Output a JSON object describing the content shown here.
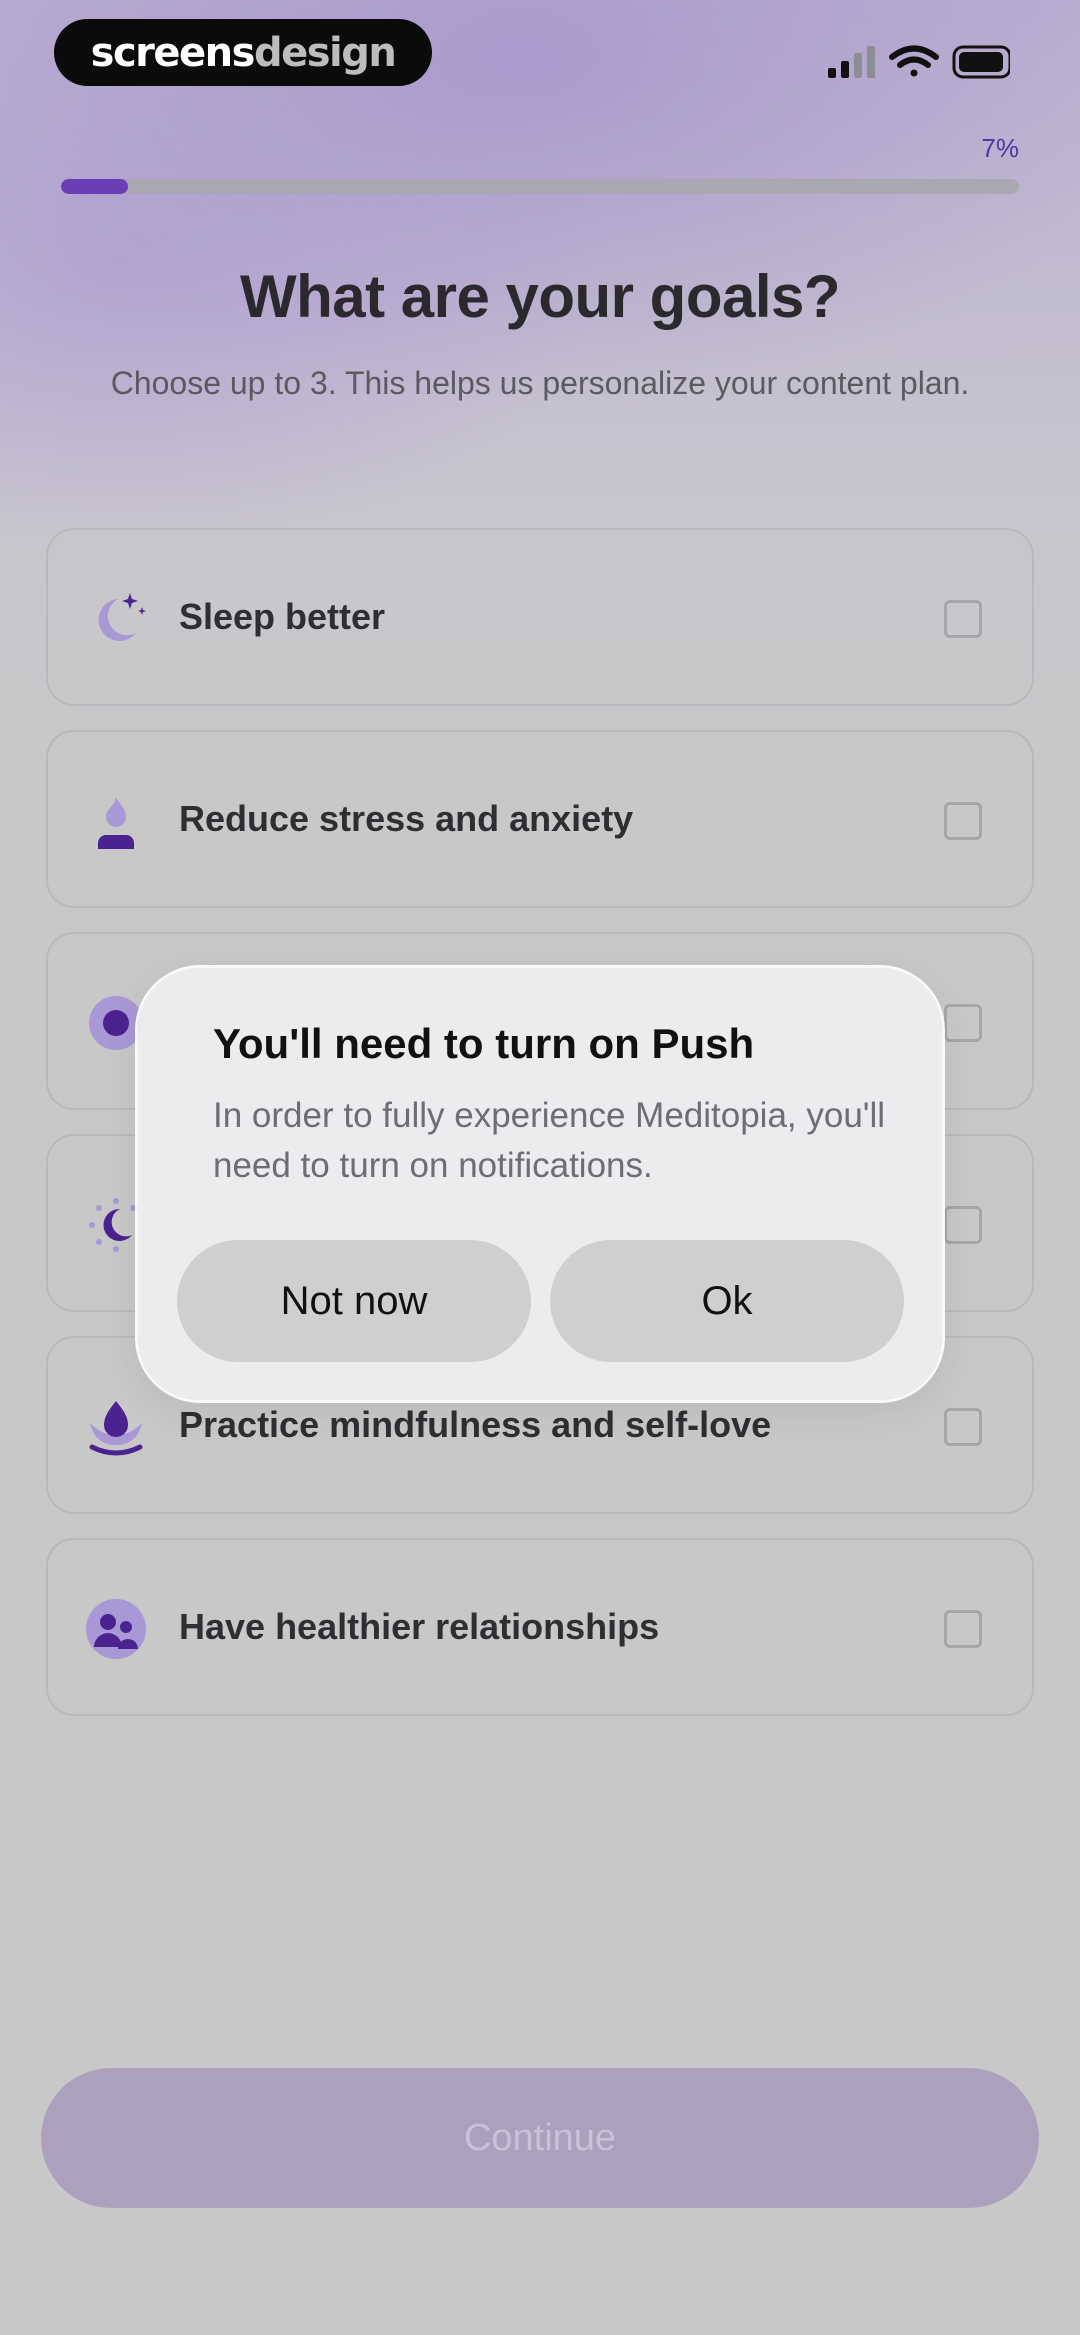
{
  "status_bar": {
    "brand_part1": "screens",
    "brand_part2": "design",
    "icons": [
      "cellular-signal-icon",
      "wifi-icon",
      "battery-icon"
    ]
  },
  "progress": {
    "label": "7%",
    "value": 0.07
  },
  "header": {
    "title": "What are your goals?",
    "subtitle": "Choose up to 3. This helps us personalize your content plan."
  },
  "goals": [
    {
      "label": "Sleep better",
      "icon": "moon-sparkle-icon",
      "checked": false
    },
    {
      "label": "Reduce stress and anxiety",
      "icon": "calm-person-icon",
      "checked": false
    },
    {
      "label": "",
      "icon": "sun-flower-icon",
      "checked": false
    },
    {
      "label": "",
      "icon": "sun-moon-icon",
      "checked": false
    },
    {
      "label": "Practice mindfulness and self-love",
      "icon": "lotus-icon",
      "checked": false
    },
    {
      "label": "Have healthier relationships",
      "icon": "people-icon",
      "checked": false
    }
  ],
  "continue_label": "Continue",
  "dialog": {
    "title": "You'll need to turn on Push",
    "message": "In order to fully experience Meditopia, you'll need to turn on notifications.",
    "not_now_label": "Not now",
    "ok_label": "Ok"
  },
  "colors": {
    "accent": "#6a3fb6",
    "icon_purple": "#4b2390",
    "icon_lavender": "#a898d6"
  }
}
